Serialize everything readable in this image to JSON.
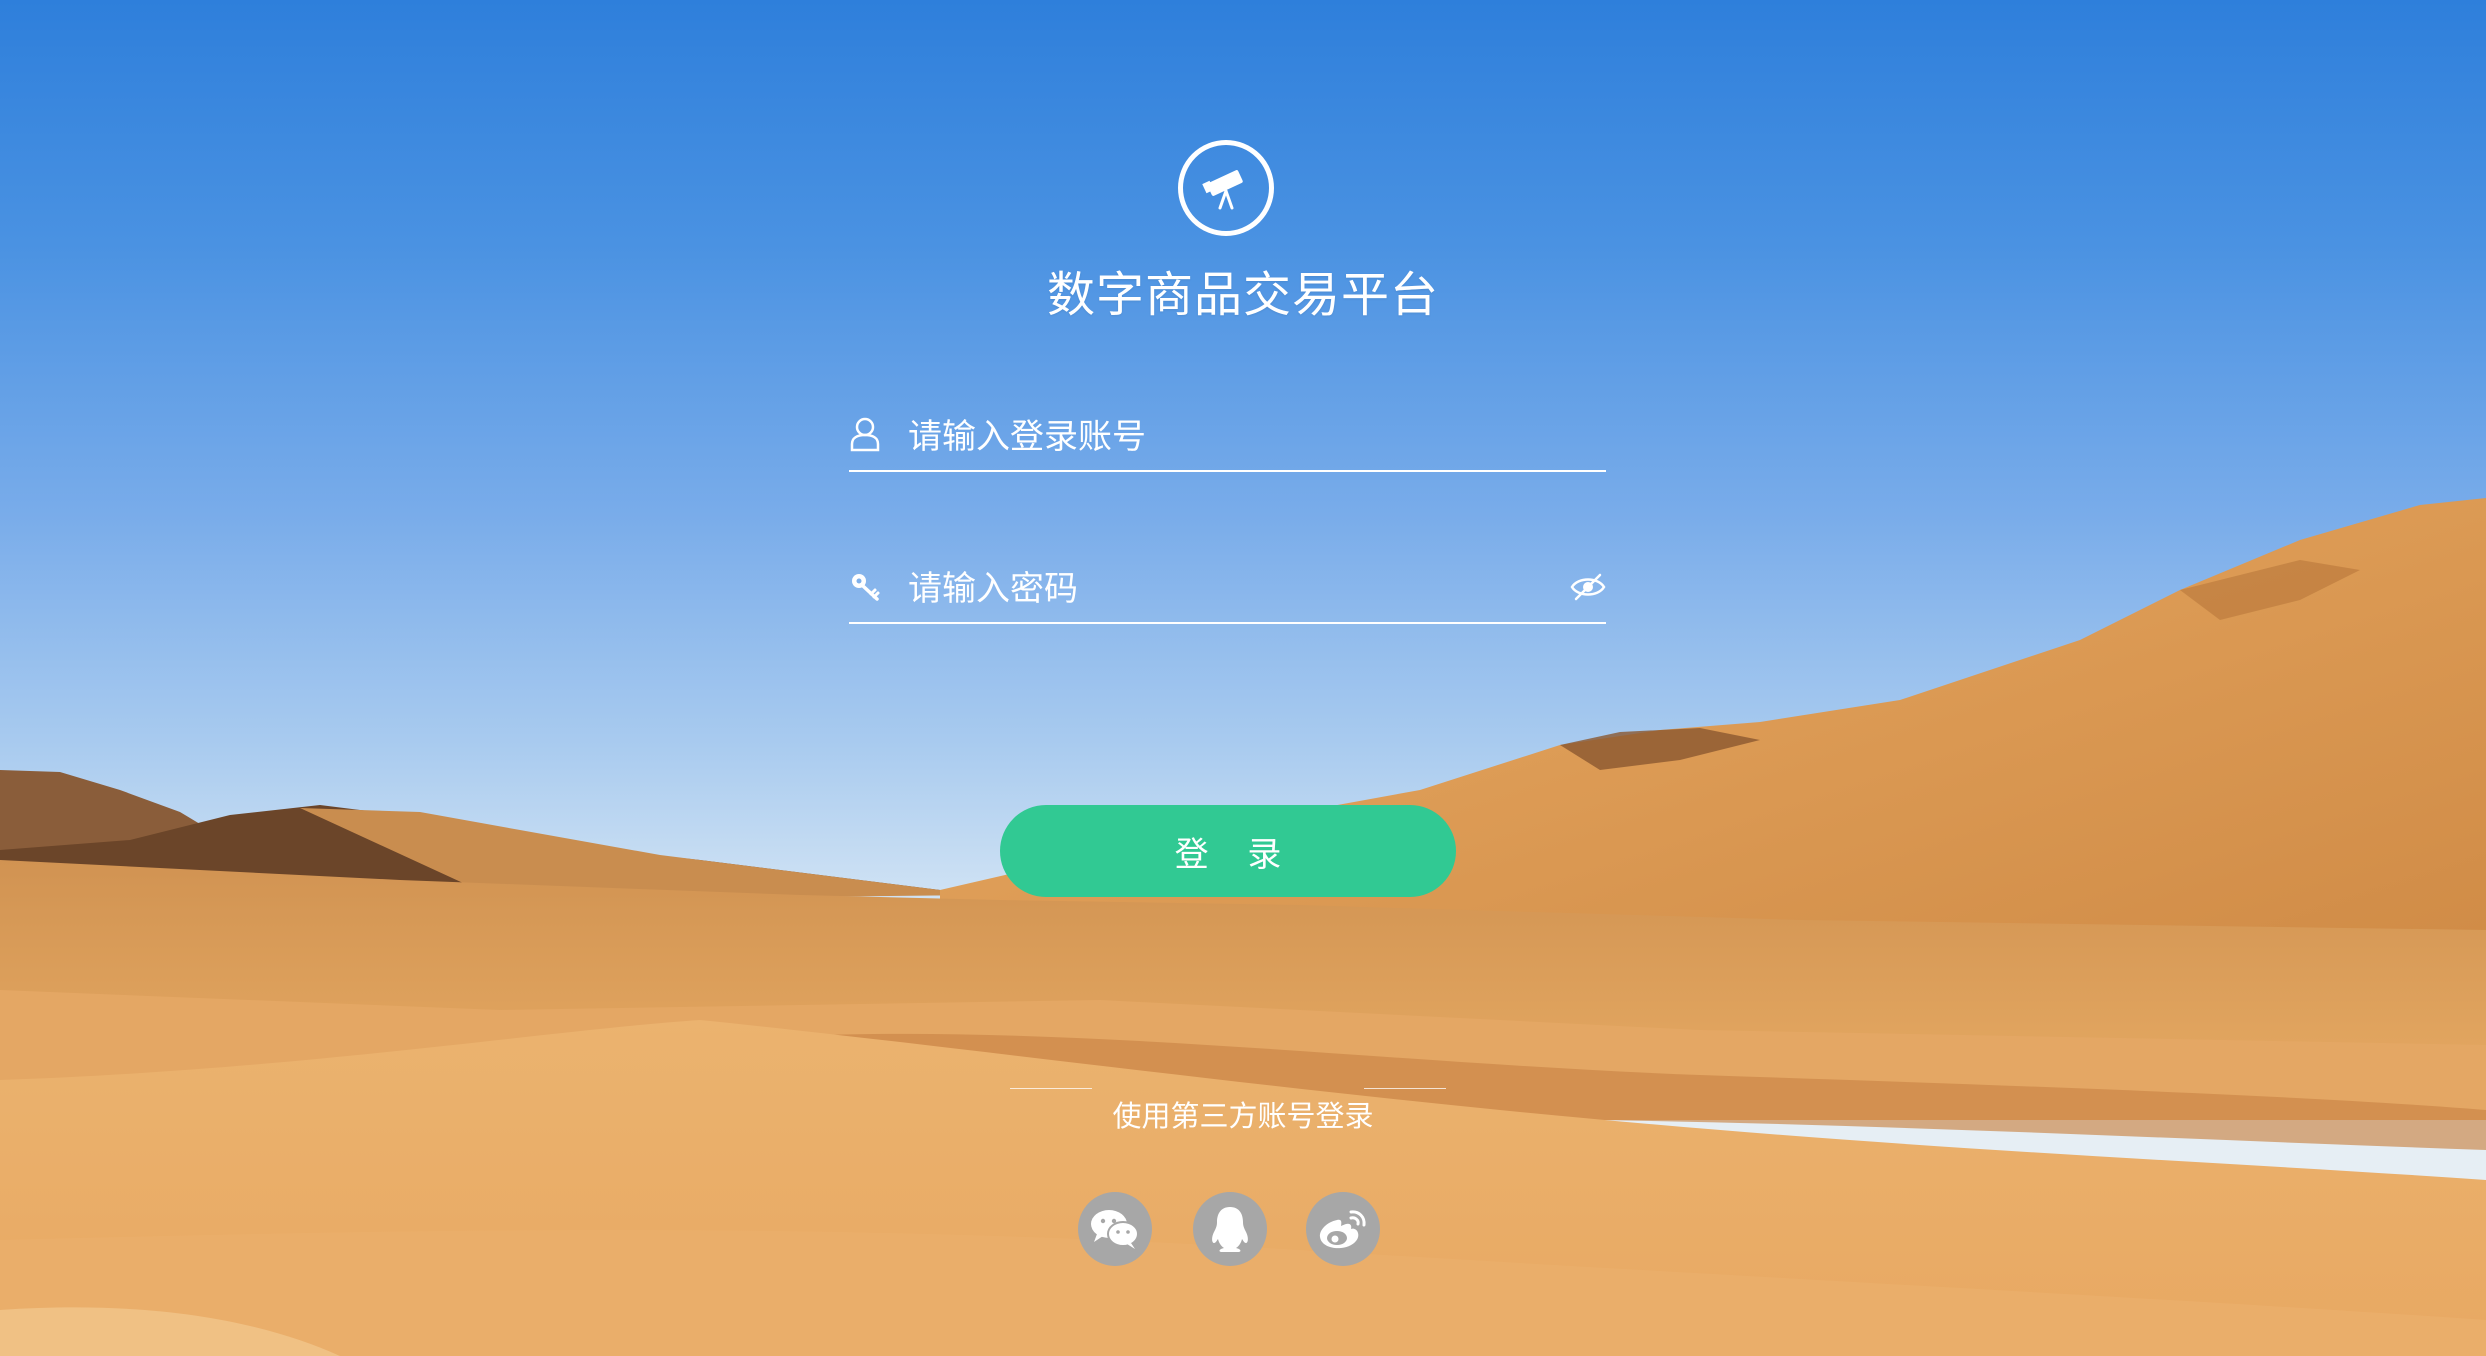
{
  "app": {
    "title": "数字商品交易平台"
  },
  "login_form": {
    "username_placeholder": "请输入登录账号",
    "password_placeholder": "请输入密码",
    "login_button_label": "登 录"
  },
  "third_party": {
    "label": "使用第三方账号登录",
    "providers": [
      "wechat-icon",
      "qq-icon",
      "weibo-icon"
    ]
  },
  "colors": {
    "login_button": "#31c993",
    "social_icon_bg": "#a7a7a7",
    "sky_top": "#2e7fdb",
    "sand": "#e3a45f"
  },
  "icons": {
    "logo": "telescope-icon",
    "username": "user-icon",
    "password": "key-icon",
    "toggle_password": "eye-slash-icon"
  }
}
